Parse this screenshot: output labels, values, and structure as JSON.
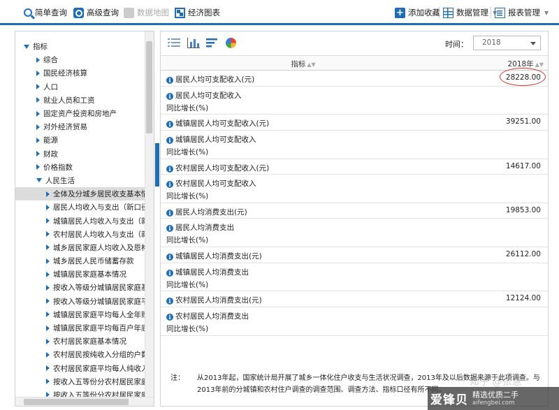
{
  "toolbar": {
    "simple_query": "简单查询",
    "advanced_query": "高级查询",
    "data_map": "数据地图",
    "econ_chart": "经济图表",
    "add_favorite": "添加收藏",
    "data_manage": "数据管理",
    "report_manage": "报表管理"
  },
  "tree": {
    "root": "指标",
    "items": [
      {
        "label": "综合"
      },
      {
        "label": "国民经济核算"
      },
      {
        "label": "人口"
      },
      {
        "label": "就业人员和工资"
      },
      {
        "label": "固定资产投资和房地产"
      },
      {
        "label": "对外经济贸易"
      },
      {
        "label": "能源"
      },
      {
        "label": "财政"
      },
      {
        "label": "价格指数"
      },
      {
        "label": "人民生活"
      }
    ],
    "sub_items": [
      {
        "label": "全体及分城乡居民收支基本情况"
      },
      {
        "label": "居民人均收入与支出（新口径）"
      },
      {
        "label": "城镇居民人均收入与支出（新口径）"
      },
      {
        "label": "农村居民人均收入与支出（新口径）"
      },
      {
        "label": "城乡居民家庭人均收入及恩格尔系数"
      },
      {
        "label": "城乡居民人民币储蓄存款"
      },
      {
        "label": "城镇居民家庭基本情况"
      },
      {
        "label": "按收入等级分城镇居民家庭基本情况"
      },
      {
        "label": "按收入等级分城镇居民家庭平均每人"
      },
      {
        "label": "城镇居民家庭平均每人全年购买主要商品"
      },
      {
        "label": "城镇居民家庭平均每百户年底耐用消费品"
      },
      {
        "label": "农村居民家庭基本情况"
      },
      {
        "label": "农村居民按纯收入分组的户数占调查户"
      },
      {
        "label": "农村居民家庭平均每人纯收入"
      },
      {
        "label": "按收入五等份分农村居民家庭基本情况"
      },
      {
        "label": "按收入五等份分农村居民家庭平均每人"
      }
    ]
  },
  "right": {
    "time_label": "时间：",
    "time_value": "2018",
    "col_indicator": "指标",
    "col_year": "2018年",
    "rows": [
      {
        "name": "居民人均可支配收入(元)",
        "value": "28228.00",
        "highlight": true
      },
      {
        "name": "居民人均可支配收入",
        "name2": "同比增长(%)",
        "value": ""
      },
      {
        "name": "城镇居民人均可支配收入(元)",
        "value": "39251.00"
      },
      {
        "name": "城镇居民人均可支配收入",
        "name2": "同比增长(%)",
        "value": ""
      },
      {
        "name": "农村居民人均可支配收入(元)",
        "value": "14617.00"
      },
      {
        "name": "农村居民人均可支配收入",
        "name2": "同比增长(%)",
        "value": ""
      },
      {
        "name": "居民人均消费支出(元)",
        "value": "19853.00"
      },
      {
        "name": "居民人均消费支出",
        "name2": "同比增长(%)",
        "value": ""
      },
      {
        "name": "城镇居民人均消费支出(元)",
        "value": "26112.00"
      },
      {
        "name": "城镇居民人均消费支出",
        "name2": "同比增长(%)",
        "value": ""
      },
      {
        "name": "农村居民人均消费支出(元)",
        "value": "12124.00"
      },
      {
        "name": "农村居民人均消费支出",
        "name2": "同比增长(%)",
        "value": ""
      }
    ],
    "note_label": "注：",
    "note_text": "从2013年起，国家统计局开展了城乡一体化住户收支与生活状况调查，2013年及以后数据来源于此项调查。与2013年前的分城镇和农村住户调查的调查范围、调查方法、指标口径有所不同。"
  },
  "watermark": {
    "zhihu": "知乎 @张慧",
    "brand": "爱锋贝",
    "slogan": "精选优质二手",
    "url": "aifengbei.com"
  },
  "colors": {
    "accent": "#1f6db4",
    "highlight": "#d8302a"
  },
  "icons": [
    "search-icon",
    "advanced-search-icon",
    "map-icon",
    "chart-icon",
    "plus-icon",
    "grid-icon",
    "report-icon",
    "info-icon"
  ]
}
